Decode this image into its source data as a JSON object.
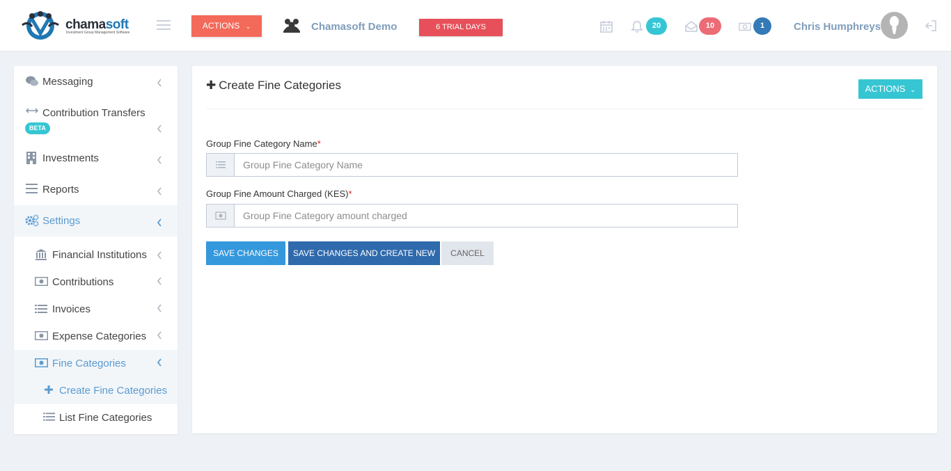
{
  "header": {
    "logo": {
      "brand_main": "chama",
      "brand_accent": "soft",
      "tagline": "Investment Group Management Software"
    },
    "actions_label": "ACTIONS",
    "group_name": "Chamasoft Demo",
    "trial_label": "6 TRIAL DAYS",
    "notifications_count": "20",
    "messages_count": "10",
    "payments_count": "1",
    "username": "Chris Humphreys",
    "colors": {
      "actions": "#f36a5a",
      "trial": "#e7505a",
      "notifications": "#36c6d3",
      "messages": "#ed6b75",
      "payments": "#337ab7"
    }
  },
  "sidebar": {
    "items": [
      {
        "label": "Messaging",
        "icon": "chat-icon"
      },
      {
        "label": "Contribution Transfers",
        "icon": "arrows-horizontal-icon",
        "badge": "BETA"
      },
      {
        "label": "Investments",
        "icon": "building-icon"
      },
      {
        "label": "Reports",
        "icon": "menu-lines-icon"
      },
      {
        "label": "Settings",
        "icon": "gears-icon",
        "active": true
      }
    ],
    "settings_children": [
      {
        "label": "Financial Institutions",
        "icon": "bank-icon"
      },
      {
        "label": "Contributions",
        "icon": "money-icon"
      },
      {
        "label": "Invoices",
        "icon": "list-icon"
      },
      {
        "label": "Expense Categories",
        "icon": "money-icon"
      },
      {
        "label": "Fine Categories",
        "icon": "money-icon",
        "active": true
      }
    ],
    "fine_children": [
      {
        "label": "Create Fine Categories",
        "icon": "plus-icon",
        "active": true
      },
      {
        "label": "List Fine Categories",
        "icon": "list-icon"
      }
    ]
  },
  "main": {
    "title": "Create Fine Categories",
    "actions_label": "ACTIONS",
    "form": {
      "name_label": "Group Fine Category Name",
      "name_placeholder": "Group Fine Category Name",
      "amount_label": "Group Fine Amount Charged (KES)",
      "amount_placeholder": "Group Fine Category amount charged",
      "required_mark": "*"
    },
    "buttons": {
      "save": "SAVE CHANGES",
      "save_new": "SAVE CHANGES AND CREATE NEW",
      "cancel": "CANCEL"
    }
  }
}
